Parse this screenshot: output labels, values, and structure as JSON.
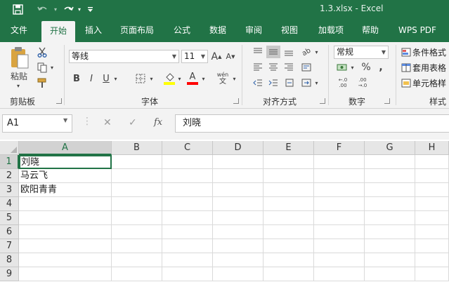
{
  "window": {
    "title": "1.3.xlsx  -  Excel",
    "qa_icons": [
      "save-icon",
      "undo-icon",
      "redo-icon",
      "customize-icon"
    ]
  },
  "tabs": [
    "文件",
    "开始",
    "插入",
    "页面布局",
    "公式",
    "数据",
    "审阅",
    "视图",
    "加载项",
    "帮助",
    "WPS PDF"
  ],
  "active_tab": "开始",
  "ribbon": {
    "clipboard": {
      "paste_label": "粘贴",
      "group_label": "剪贴板"
    },
    "font": {
      "font_name": "等线",
      "font_size": "11",
      "grow": "A",
      "shrink": "A",
      "bold": "B",
      "italic": "I",
      "underline": "U",
      "font_color_glyph": "A",
      "phonetic": "wén",
      "group_label": "字体",
      "highlight_color": "#ffff00",
      "font_color": "#ff0000"
    },
    "alignment": {
      "group_label": "对齐方式",
      "wrap": "ab"
    },
    "number": {
      "format": "常规",
      "percent": "%",
      "comma": ",",
      "group_label": "数字"
    },
    "styles": {
      "conditional": "条件格式",
      "table": "套用表格",
      "cell": "单元格样",
      "group_label": "样式"
    }
  },
  "formula_bar": {
    "name_box": "A1",
    "fx": "fx",
    "cancel": "✕",
    "enter": "✓",
    "content": "刘晓"
  },
  "sheet": {
    "columns": [
      "A",
      "B",
      "C",
      "D",
      "E",
      "F",
      "G",
      "H"
    ],
    "rows": [
      "1",
      "2",
      "3",
      "4",
      "5",
      "6",
      "7",
      "8",
      "9"
    ],
    "cells": [
      [
        "刘晓",
        "",
        "",
        "",
        "",
        "",
        "",
        ""
      ],
      [
        "马云飞",
        "",
        "",
        "",
        "",
        "",
        "",
        ""
      ],
      [
        "欧阳青青",
        "",
        "",
        "",
        "",
        "",
        "",
        ""
      ],
      [
        "",
        "",
        "",
        "",
        "",
        "",
        "",
        ""
      ],
      [
        "",
        "",
        "",
        "",
        "",
        "",
        "",
        ""
      ],
      [
        "",
        "",
        "",
        "",
        "",
        "",
        "",
        ""
      ],
      [
        "",
        "",
        "",
        "",
        "",
        "",
        "",
        ""
      ],
      [
        "",
        "",
        "",
        "",
        "",
        "",
        "",
        ""
      ],
      [
        "",
        "",
        "",
        "",
        "",
        "",
        "",
        ""
      ]
    ],
    "active_cell": "A1",
    "accent_color": "#217346"
  }
}
